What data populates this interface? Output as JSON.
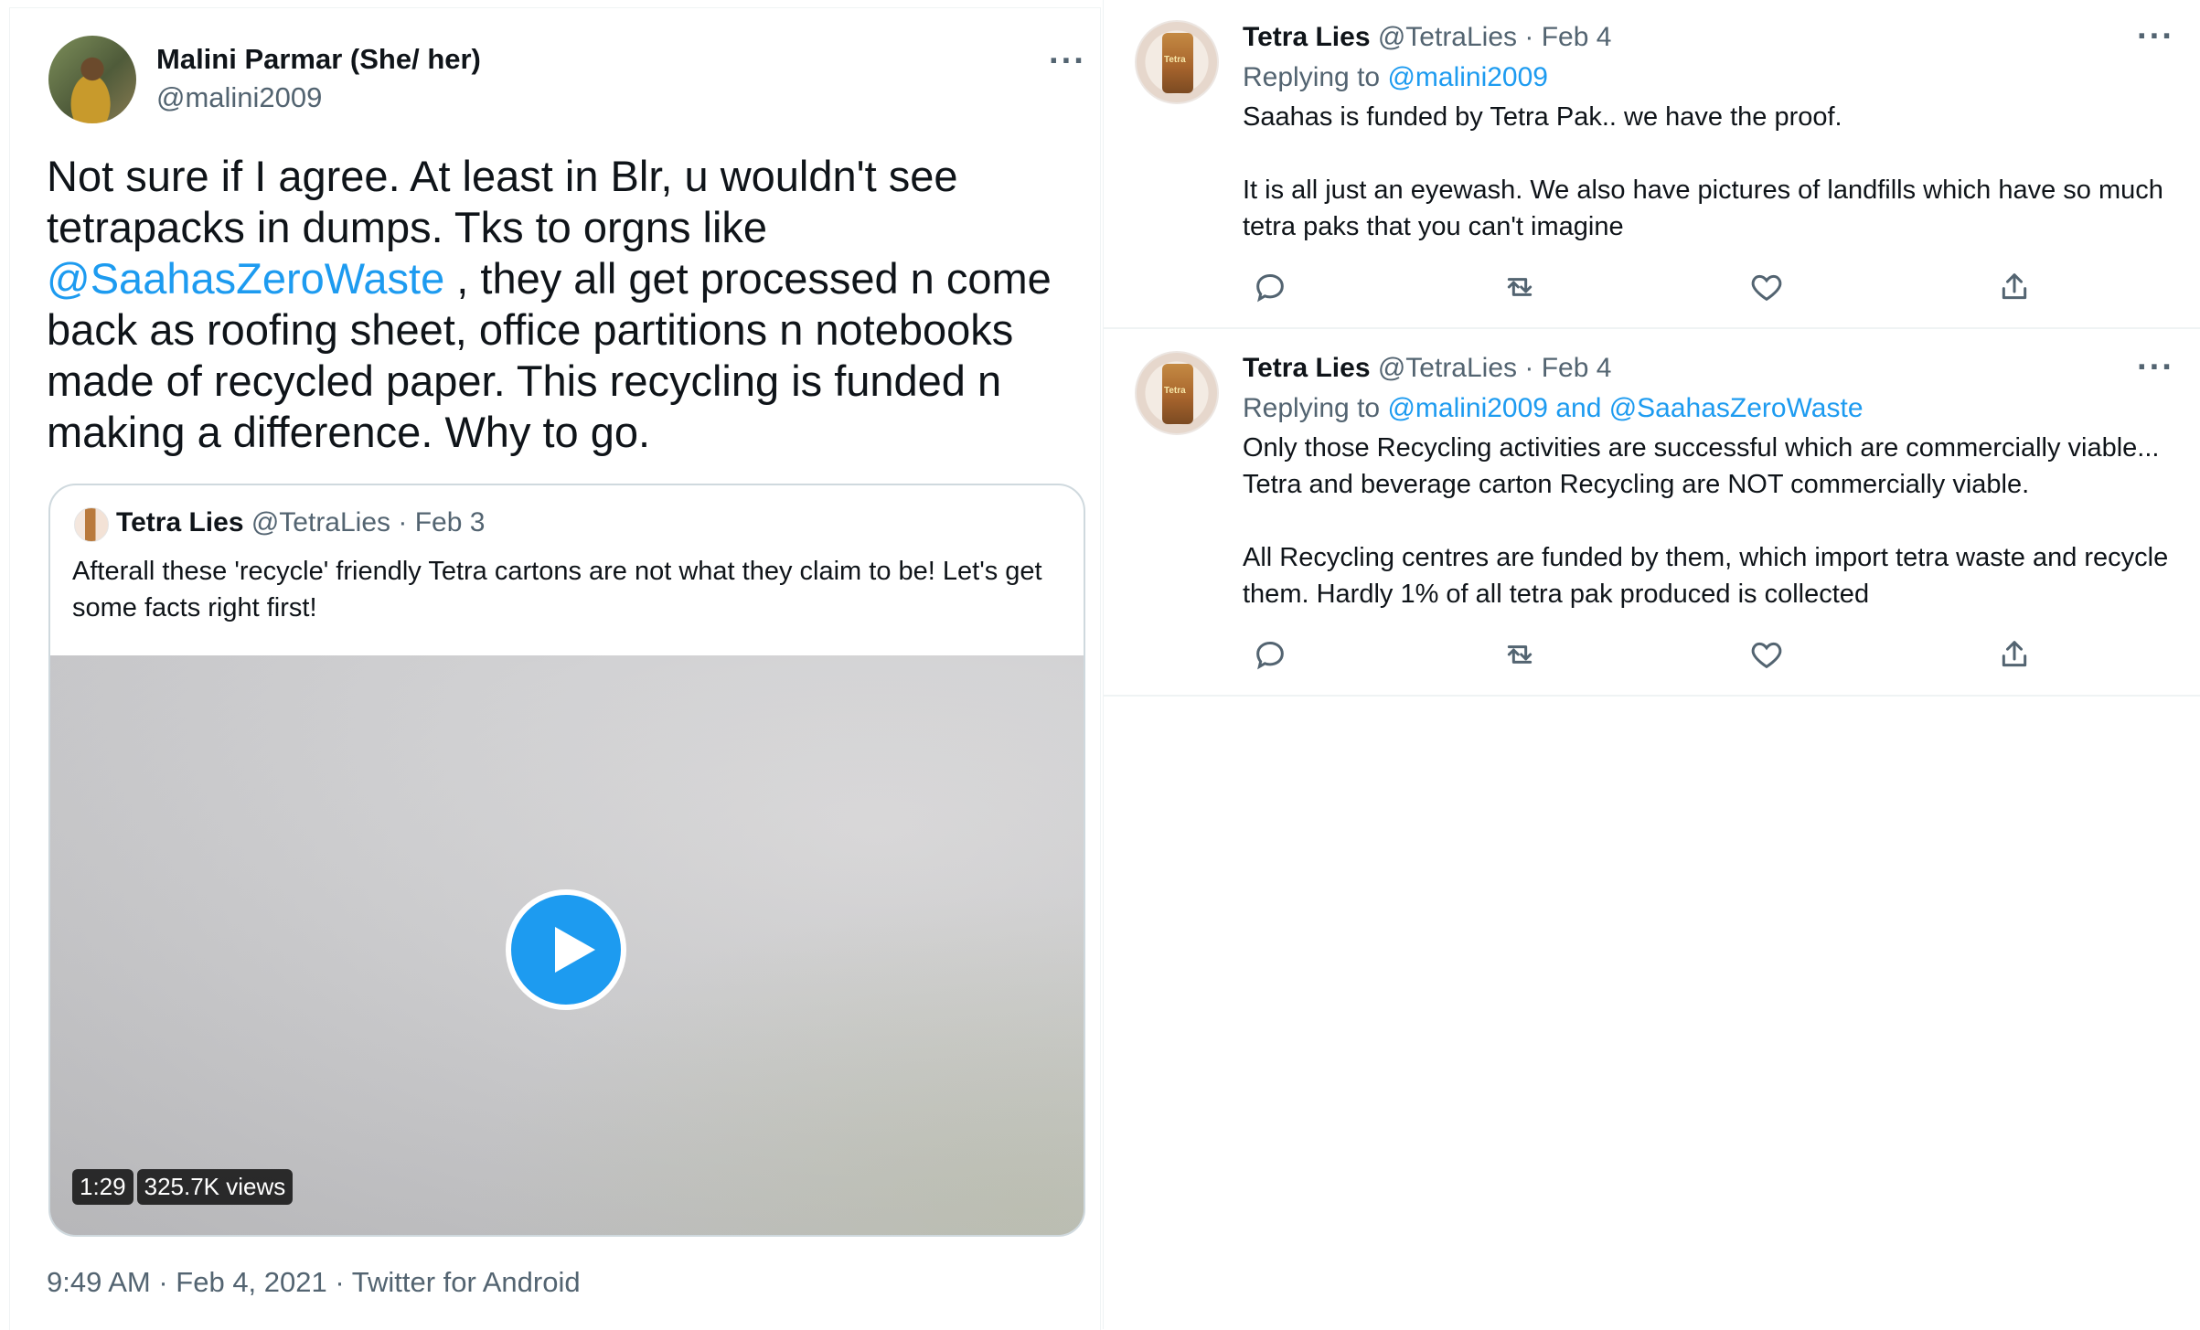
{
  "main_tweet": {
    "author_name": "Malini Parmar (She/ her)",
    "author_handle": "@malini2009",
    "text_part1": "Not sure if I agree. At least in Blr, u wouldn't see tetrapacks in dumps. Tks to orgns like ",
    "mention": "@SaahasZeroWaste",
    "text_part2": " , they all get processed n come back as roofing sheet, office partitions n notebooks made of recycled paper. This recycling is funded n making a difference. Why to go.",
    "timestamp": "9:49 AM · Feb 4, 2021 · Twitter for Android",
    "more_label": "···"
  },
  "quoted_tweet": {
    "author_name": "Tetra Lies",
    "author_handle": "@TetraLies",
    "date": "· Feb 3",
    "text": "Afterall these 'recycle' friendly Tetra cartons are not what they claim to be! Let's get some facts right first!",
    "video_duration": "1:29",
    "video_views": "325.7K views"
  },
  "replies": [
    {
      "author_name": "Tetra Lies",
      "author_handle": "@TetraLies",
      "date": "· Feb 4",
      "replying_label": "Replying to ",
      "replying_to": "@malini2009",
      "text": "Saahas is funded by Tetra Pak.. we have the proof.\n\nIt is all just an eyewash. We also have pictures of landfills which have so much tetra paks that you can't imagine",
      "more_label": "···"
    },
    {
      "author_name": "Tetra Lies",
      "author_handle": "@TetraLies",
      "date": "· Feb 4",
      "replying_label": "Replying to ",
      "replying_to": "@malini2009 and @SaahasZeroWaste",
      "text": "Only those Recycling activities are successful which are commercially viable... Tetra and beverage carton Recycling are NOT commercially viable.\n\nAll Recycling centres are funded by them, which import tetra waste and recycle them. Hardly 1% of all tetra pak produced is collected",
      "more_label": "···"
    }
  ],
  "icons": [
    "reply-icon",
    "retweet-icon",
    "like-icon",
    "share-icon",
    "play-icon",
    "more-icon"
  ],
  "colors": {
    "link": "#1d9bf0",
    "muted": "#536471",
    "text": "#0f1419",
    "border": "#cfd9de"
  }
}
